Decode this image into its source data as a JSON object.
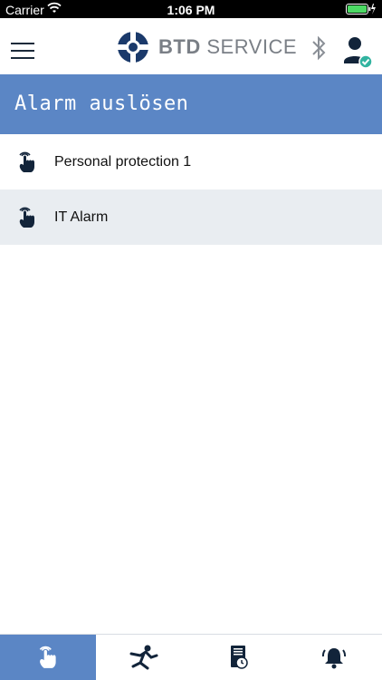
{
  "status_bar": {
    "carrier": "Carrier",
    "time": "1:06 PM"
  },
  "header": {
    "brand_bold": "BTD",
    "brand_rest": "SERVICE"
  },
  "title": "Alarm auslösen",
  "alarms": [
    {
      "label": "Personal protection 1"
    },
    {
      "label": "IT Alarm"
    }
  ],
  "icons": {
    "menu": "hamburger-menu-icon",
    "bluetooth": "bluetooth-icon",
    "user": "user-verified-icon",
    "row": "hand-touch-icon",
    "tabs": [
      "hand-touch-icon",
      "fall-person-icon",
      "device-timer-icon",
      "alarm-bell-icon"
    ]
  },
  "colors": {
    "accent": "#5b86c5",
    "navy": "#1b2a3a",
    "row_alt": "#e9edf1"
  },
  "active_tab": 0
}
